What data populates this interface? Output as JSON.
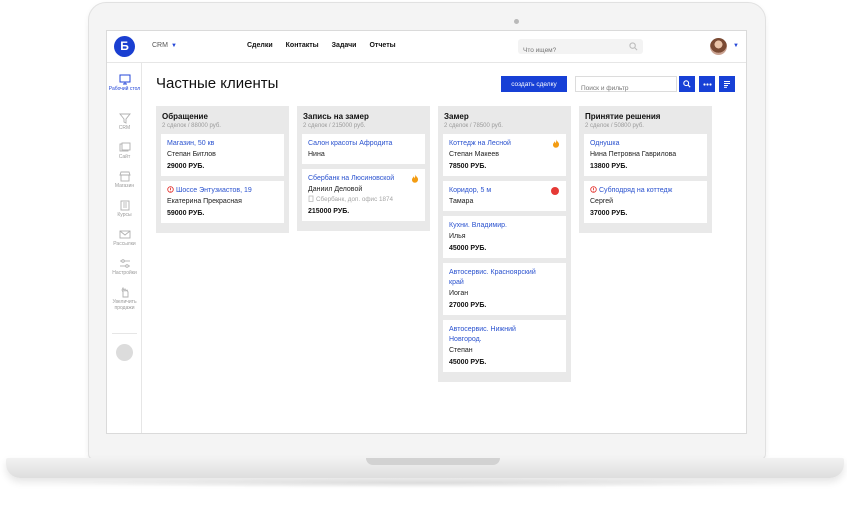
{
  "app": {
    "logo_letter": "Б",
    "module": "CRM",
    "nav": [
      "Сделки",
      "Контакты",
      "Задачи",
      "Отчеты"
    ],
    "search_placeholder": "Что ищем?"
  },
  "sidebar": {
    "items": [
      {
        "label": "Рабочий стол",
        "icon": "desktop-icon",
        "active": true
      },
      {
        "label": "CRM",
        "icon": "funnel-icon",
        "active": false
      },
      {
        "label": "Сайт",
        "icon": "site-icon",
        "active": false
      },
      {
        "label": "Магазин",
        "icon": "store-icon",
        "active": false
      },
      {
        "label": "Курсы",
        "icon": "book-icon",
        "active": false
      },
      {
        "label": "Рассылки",
        "icon": "mail-icon",
        "active": false
      },
      {
        "label": "Настройки",
        "icon": "settings-icon",
        "active": false
      },
      {
        "label": "Увеличить продажи",
        "icon": "growth-icon",
        "active": false
      }
    ]
  },
  "page": {
    "title": "Частные клиенты",
    "create_button": "создать сделку",
    "filter_placeholder": "Поиск и фильтр"
  },
  "columns": [
    {
      "title": "Обращение",
      "subtitle": "2 сделок / 88000 руб.",
      "cards": [
        {
          "title": "Магазин, 50 кв",
          "contact": "Степан Битлов",
          "price": "29000 РУБ."
        },
        {
          "title": "Шоссе Энтузиастов, 19",
          "contact": "Екатерина Прекрасная",
          "price": "59000 РУБ.",
          "alert": true
        }
      ]
    },
    {
      "title": "Запись на замер",
      "subtitle": "2 сделок / 215000 руб.",
      "cards": [
        {
          "title": "Салон красоты Афродита",
          "contact": "Нина"
        },
        {
          "title": "Сбербанк на Люсиновской",
          "contact": "Даниил Деловой",
          "note": "Сбербанк, доп. офис 1874",
          "price": "215000 РУБ.",
          "hot": true
        }
      ]
    },
    {
      "title": "Замер",
      "subtitle": "2 сделок / 78500 руб.",
      "cards": [
        {
          "title": "Коттедж на Лесной",
          "contact": "Степан Макеев",
          "price": "78500 РУБ.",
          "hot": true
        },
        {
          "title": "Коридор, 5 м",
          "contact": "Тамара",
          "warn": true
        },
        {
          "title": "Кухни. Владимир.",
          "contact": "Илья",
          "price": "45000 РУБ."
        },
        {
          "title": "Автосервис. Красноярский край",
          "contact": "Иоган",
          "price": "27000 РУБ."
        },
        {
          "title": "Автосервис. Нижний Новгород.",
          "contact": "Степан",
          "price": "45000 РУБ."
        }
      ]
    },
    {
      "title": "Принятие решения",
      "subtitle": "2 сделок / 50800 руб.",
      "cards": [
        {
          "title": "Однушка",
          "contact": "Нина Петровна Гаврилова",
          "price": "13800 РУБ."
        },
        {
          "title": "Субподряд на коттедж",
          "contact": "Сергей",
          "price": "37000 РУБ.",
          "alert": true
        }
      ]
    }
  ],
  "colors": {
    "accent": "#1740d6",
    "link": "#2a52cf",
    "column_bg": "#e9e9e9",
    "hot": "#f39c12",
    "warn": "#e53935"
  }
}
